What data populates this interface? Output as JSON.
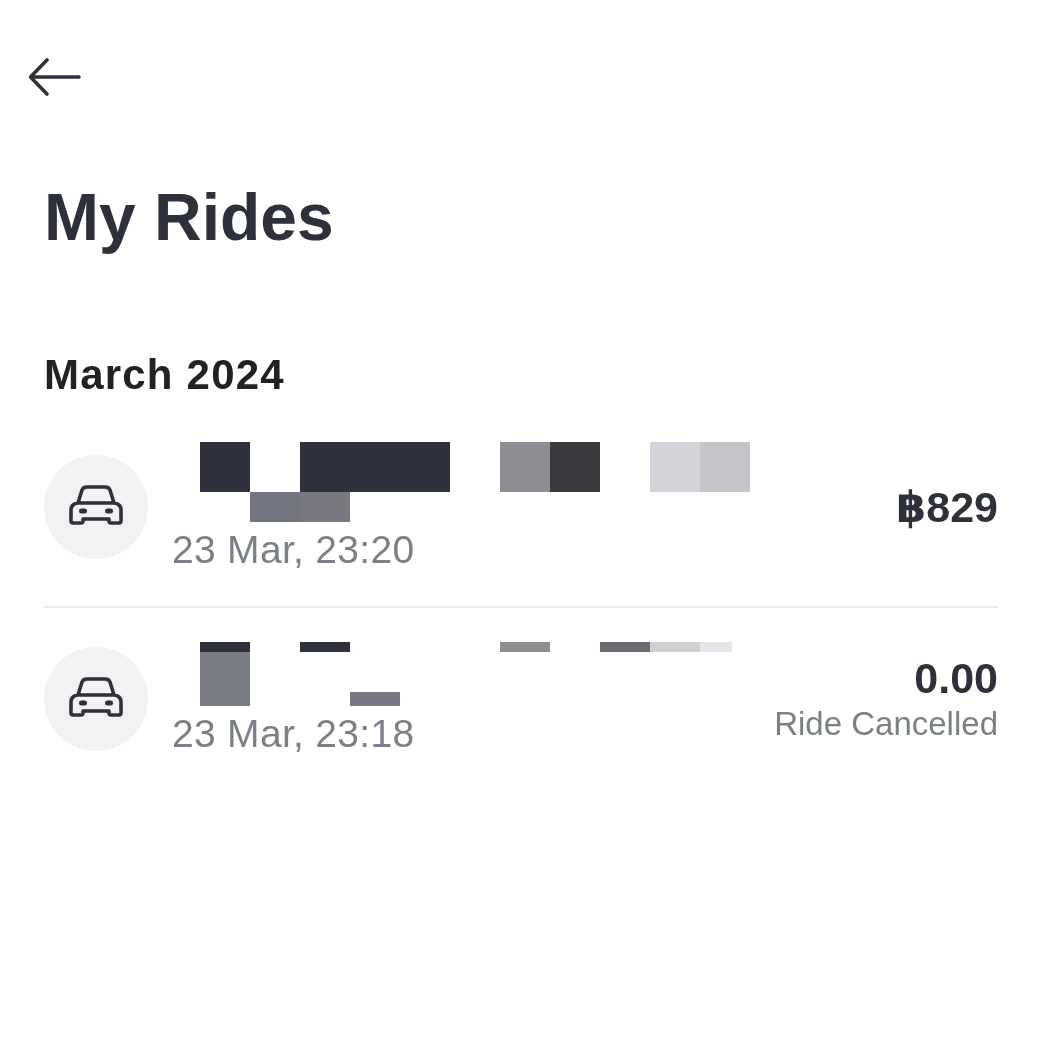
{
  "header": {
    "title": "My Rides"
  },
  "sections": [
    {
      "heading": "March 2024",
      "rides": [
        {
          "address_redacted": true,
          "date": "23 Mar, 23:20",
          "amount": "฿829"
        },
        {
          "address_redacted": true,
          "date": "23 Mar, 23:18",
          "amount": "0.00",
          "status": "Ride Cancelled"
        }
      ]
    }
  ]
}
